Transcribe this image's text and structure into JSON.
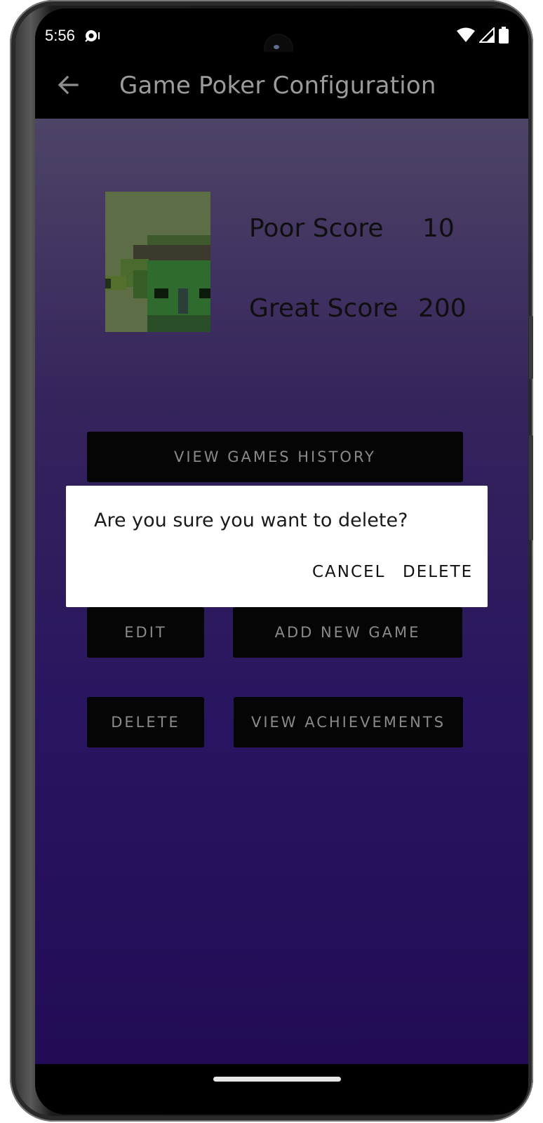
{
  "status_bar": {
    "time": "5:56",
    "notification_icon": "sync-notification-icon",
    "wifi_icon": "wifi-icon",
    "signal_icon": "cell-signal-icon",
    "battery_icon": "battery-icon"
  },
  "app_bar": {
    "back_icon": "arrow-left-icon",
    "title": "Game Poker Configuration"
  },
  "scores": {
    "poor_label": "Poor Score",
    "poor_value": "10",
    "great_label": "Great Score",
    "great_value": "200"
  },
  "buttons": {
    "view_history": "VIEW GAMES HISTORY",
    "edit": "EDIT",
    "add_new_game": "ADD NEW GAME",
    "delete": "DELETE",
    "view_achievements": "VIEW ACHIEVEMENTS"
  },
  "dialog": {
    "message": "Are you sure you want to delete?",
    "cancel": "CANCEL",
    "delete": "DELETE"
  },
  "colors": {
    "background_top": "#4e4466",
    "background_bottom": "#220c56",
    "button_bg": "#050505",
    "button_text": "#8a8a8a",
    "dialog_bg": "#ffffff"
  }
}
